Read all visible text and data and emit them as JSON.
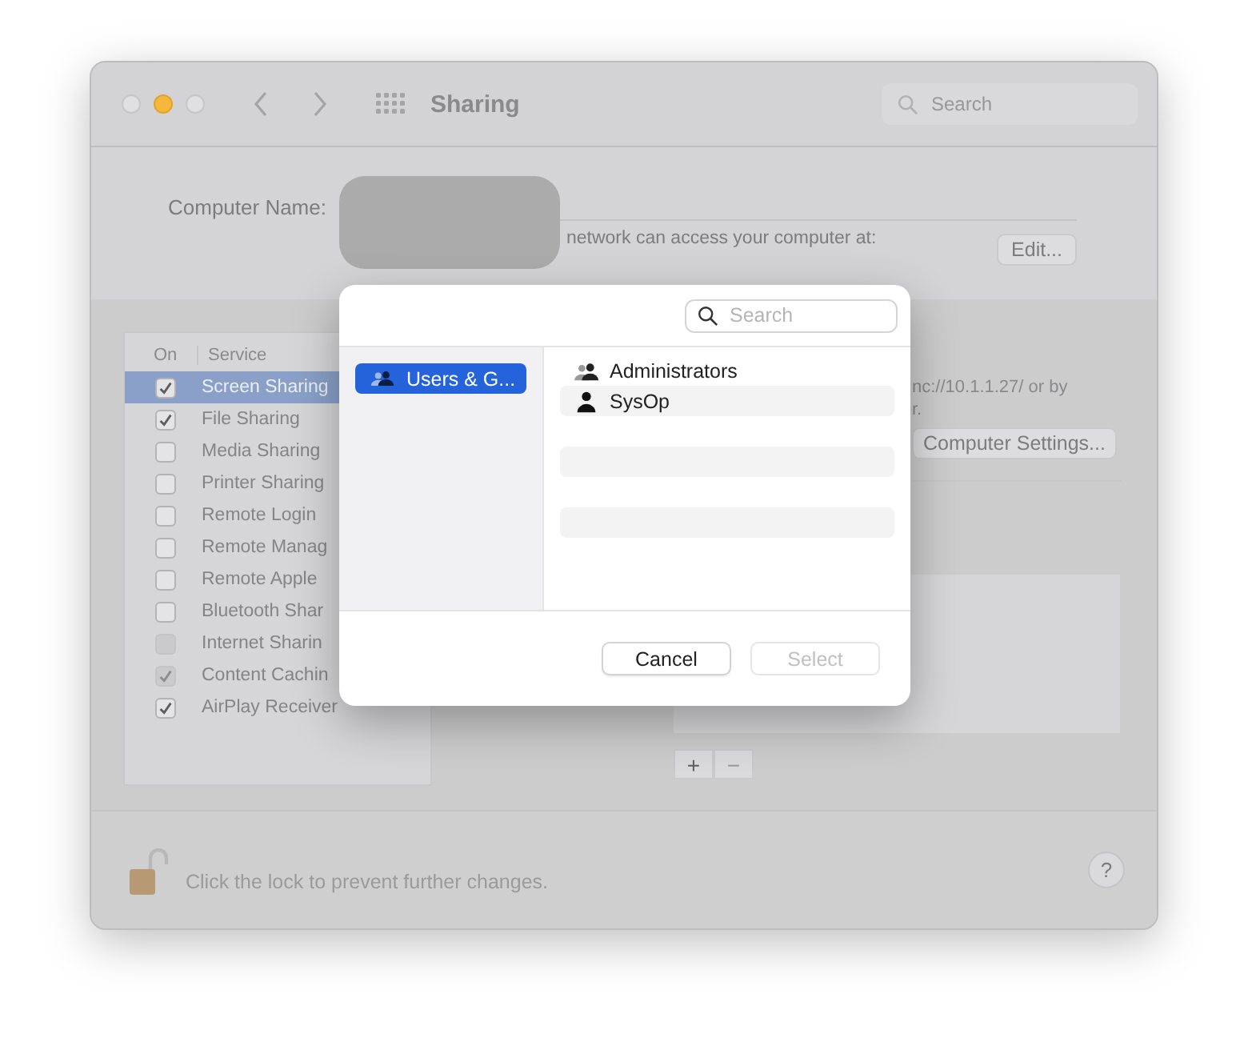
{
  "window": {
    "title": "Sharing",
    "search": {
      "placeholder": "Search"
    }
  },
  "computer_name": {
    "label": "Computer Name:",
    "note": "network can access your computer at:",
    "edit_button": "Edit..."
  },
  "services": {
    "columns": [
      "On",
      "Service"
    ],
    "rows": [
      {
        "name": "Screen Sharing",
        "checked": true,
        "disabled": false,
        "selected": true
      },
      {
        "name": "File Sharing",
        "checked": true,
        "disabled": false,
        "selected": false
      },
      {
        "name": "Media Sharing",
        "checked": false,
        "disabled": false,
        "selected": false
      },
      {
        "name": "Printer Sharing",
        "checked": false,
        "disabled": false,
        "selected": false
      },
      {
        "name": "Remote Login",
        "checked": false,
        "disabled": false,
        "selected": false
      },
      {
        "name": "Remote Manag",
        "checked": false,
        "disabled": false,
        "selected": false
      },
      {
        "name": "Remote Apple",
        "checked": false,
        "disabled": false,
        "selected": false
      },
      {
        "name": "Bluetooth Shar",
        "checked": false,
        "disabled": false,
        "selected": false
      },
      {
        "name": "Internet Sharin",
        "checked": false,
        "disabled": true,
        "selected": false
      },
      {
        "name": "Content Cachin",
        "checked": true,
        "disabled": true,
        "selected": false
      },
      {
        "name": "AirPlay Receiver",
        "checked": true,
        "disabled": false,
        "selected": false
      }
    ]
  },
  "detail": {
    "lines": [
      "nc://10.1.1.27/ or by",
      "r."
    ],
    "settings_button": "Computer Settings...",
    "add_button": "+",
    "remove_button": {
      "label": "−",
      "disabled": true
    }
  },
  "footer": {
    "lock_text": "Click the lock to prevent further changes.",
    "help_button": "?"
  },
  "dialog": {
    "search": {
      "placeholder": "Search"
    },
    "sources": [
      {
        "label": "Users & G...",
        "selected": true
      }
    ],
    "members": [
      {
        "name": "Administrators",
        "kind": "group"
      },
      {
        "name": "SysOp",
        "kind": "user"
      }
    ],
    "buttons": [
      {
        "label": "Cancel",
        "disabled": false
      },
      {
        "label": "Select",
        "disabled": true
      }
    ]
  }
}
